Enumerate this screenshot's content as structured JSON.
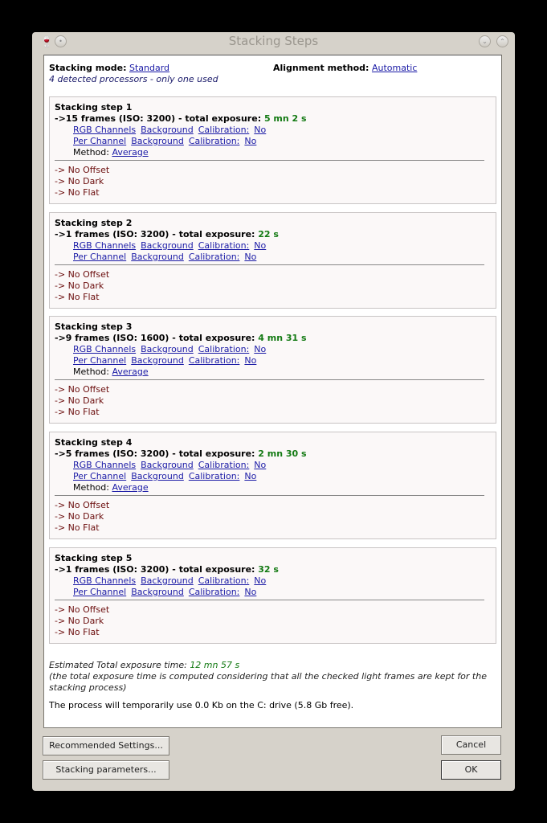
{
  "window": {
    "title": "Stacking Steps"
  },
  "header": {
    "mode_label": "Stacking mode:",
    "mode_value": "Standard",
    "align_label": "Alignment  method:",
    "align_value": "Automatic",
    "processors": "4 detected processors - only one used"
  },
  "steps": [
    {
      "title": "Stacking  step 1",
      "frames": "->15 frames (ISO: 3200) - total exposure:",
      "exposure": "5 mn 2 s",
      "method": "Average"
    },
    {
      "title": "Stacking  step 2",
      "frames": "->1 frames (ISO: 3200) - total exposure:",
      "exposure": "22 s",
      "method": null
    },
    {
      "title": "Stacking  step 3",
      "frames": "->9 frames (ISO: 1600) - total exposure:",
      "exposure": "4 mn 31 s",
      "method": "Average"
    },
    {
      "title": "Stacking  step 4",
      "frames": "->5 frames (ISO: 3200) - total exposure:",
      "exposure": "2 mn 30 s",
      "method": "Average"
    },
    {
      "title": "Stacking  step 5",
      "frames": "->1 frames (ISO: 3200) - total exposure:",
      "exposure": "32 s",
      "method": null
    }
  ],
  "labels": {
    "rgb": "RGB Channels",
    "per": "Per Channel",
    "background": "Background",
    "calibration": "Calibration:",
    "no": "No",
    "method": "Method:",
    "offset": "-> No Offset",
    "dark": "-> No Dark",
    "flat": "-> No Flat"
  },
  "footer": {
    "est_label": "Estimated Total exposure time:",
    "est_value": "12 mn 57 s",
    "note": "(the total exposure time is computed considering that all the checked light frames are kept for the stacking process)",
    "disk": "The  process  will  temporarily  use 0.0 Kb on the C: drive (5.8 Gb free)."
  },
  "buttons": {
    "recommended": "Recommended Settings...",
    "parameters": "Stacking parameters...",
    "cancel": "Cancel",
    "ok": "OK"
  }
}
